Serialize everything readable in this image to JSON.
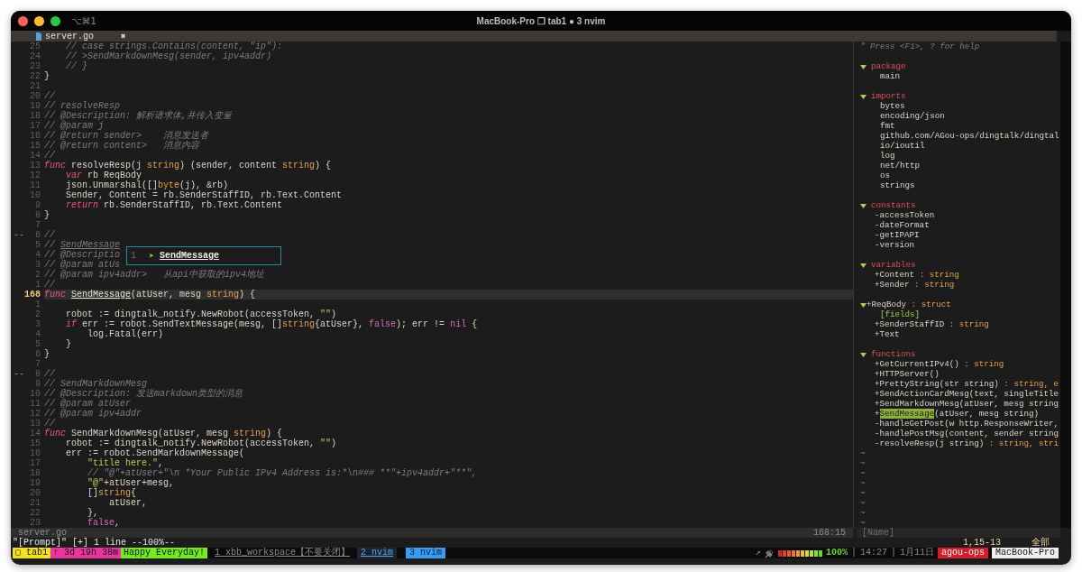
{
  "window": {
    "shortcut": "⌥⌘1",
    "title": "MacBook-Pro ❐ tab1 ● 3 nvim"
  },
  "tabline": {
    "tabs": [
      {
        "label": "server.go",
        "close": "✖",
        "selected": true
      }
    ]
  },
  "editor": {
    "lines": [
      {
        "number": "25",
        "current": false,
        "segments": [
          {
            "text": "    // case strings.Contains(content, \"ip\"):",
            "kind": "comment"
          }
        ]
      },
      {
        "number": "24",
        "current": false,
        "segments": [
          {
            "text": "    // >SendMarkdownMesg(sender, ipv4addr)",
            "kind": "comment"
          }
        ]
      },
      {
        "number": "23",
        "current": false,
        "segments": [
          {
            "text": "    // }",
            "kind": "comment"
          }
        ]
      },
      {
        "number": "22",
        "current": false,
        "segments": [
          {
            "text": "}",
            "kind": "plain"
          }
        ]
      },
      {
        "number": "21",
        "current": false
      },
      {
        "number": "20",
        "current": false,
        "segments": [
          {
            "text": "//",
            "kind": "comment"
          }
        ]
      },
      {
        "number": "19",
        "current": false,
        "segments": [
          {
            "text": "// resolveResp",
            "kind": "comment"
          }
        ]
      },
      {
        "number": "18",
        "current": false,
        "segments": [
          {
            "text": "// @Description: 解析请求体,并传入变量",
            "kind": "comment"
          }
        ]
      },
      {
        "number": "17",
        "current": false,
        "segments": [
          {
            "text": "// @param j",
            "kind": "comment"
          }
        ]
      },
      {
        "number": "16",
        "current": false,
        "segments": [
          {
            "text": "// @return sender>    消息发送者",
            "kind": "comment"
          }
        ]
      },
      {
        "number": "15",
        "current": false,
        "segments": [
          {
            "text": "// @return content>   消息内容",
            "kind": "comment"
          }
        ]
      },
      {
        "number": "14",
        "current": false,
        "segments": [
          {
            "text": "//",
            "kind": "comment"
          }
        ]
      },
      {
        "number": "13",
        "current": false,
        "segments": [
          {
            "text": "func",
            "kind": "keyword"
          },
          {
            "text": " resolveResp(j ",
            "kind": "plain"
          },
          {
            "text": "string",
            "kind": "type"
          },
          {
            "text": ") (sender, content ",
            "kind": "plain"
          },
          {
            "text": "string",
            "kind": "type"
          },
          {
            "text": ") {",
            "kind": "plain"
          }
        ]
      },
      {
        "number": "12",
        "current": false,
        "segments": [
          {
            "text": "    var",
            "kind": "keyword"
          },
          {
            "text": " rb ReqBody",
            "kind": "plain"
          }
        ]
      },
      {
        "number": "11",
        "current": false,
        "segments": [
          {
            "text": "    json.Unmarshal([]",
            "kind": "plain"
          },
          {
            "text": "byte",
            "kind": "type"
          },
          {
            "text": "(j), &rb)",
            "kind": "plain"
          }
        ]
      },
      {
        "number": "10",
        "current": false,
        "segments": [
          {
            "text": "    Sender, Content = rb.SenderStaffID, rb.Text.Content",
            "kind": "plain"
          }
        ]
      },
      {
        "number": "9",
        "current": false,
        "segments": [
          {
            "text": "    return",
            "kind": "keyword"
          },
          {
            "text": " rb.SenderStaffID, rb.Text.Content",
            "kind": "plain"
          }
        ]
      },
      {
        "number": "8",
        "current": false,
        "segments": [
          {
            "text": "}",
            "kind": "plain"
          }
        ]
      },
      {
        "number": "7",
        "current": false
      },
      {
        "number": "6",
        "sign": "--",
        "current": false,
        "segments": [
          {
            "text": "//",
            "kind": "comment"
          }
        ]
      },
      {
        "number": "5",
        "current": false,
        "segments": [
          {
            "text": "// ",
            "kind": "comment"
          },
          {
            "text": "SendMessage",
            "kind": "comment-match"
          }
        ]
      },
      {
        "number": "4",
        "current": false,
        "segments": [
          {
            "text": "// @Descriptio",
            "kind": "comment"
          }
        ]
      },
      {
        "number": "3",
        "current": false,
        "segments": [
          {
            "text": "// @param atUs",
            "kind": "comment"
          }
        ]
      },
      {
        "number": "2",
        "current": false,
        "segments": [
          {
            "text": "// @param ipv4addr>   从api中获取的ipv4地址",
            "kind": "comment"
          }
        ]
      },
      {
        "number": "1",
        "current": false,
        "segments": [
          {
            "text": "//",
            "kind": "comment"
          }
        ]
      },
      {
        "number": "168",
        "current": true,
        "segments": [
          {
            "text": "func ",
            "kind": "keyword"
          },
          {
            "text": "SendMessage",
            "kind": "match"
          },
          {
            "text": "(atUser, mesg ",
            "kind": "plain"
          },
          {
            "text": "string",
            "kind": "type"
          },
          {
            "text": ") {",
            "kind": "plain"
          }
        ]
      },
      {
        "number": "1",
        "current": false
      },
      {
        "number": "2",
        "current": false,
        "segments": [
          {
            "text": "    robot := dingtalk_notify.NewRobot(accessToken, ",
            "kind": "plain"
          },
          {
            "text": "\"\"",
            "kind": "string"
          },
          {
            "text": ")",
            "kind": "plain"
          }
        ]
      },
      {
        "number": "3",
        "current": false,
        "segments": [
          {
            "text": "    if",
            "kind": "keyword"
          },
          {
            "text": " err := robot.SendTextMessage(mesg, []",
            "kind": "plain"
          },
          {
            "text": "string",
            "kind": "type"
          },
          {
            "text": "{atUser}, ",
            "kind": "plain"
          },
          {
            "text": "false",
            "kind": "constant"
          },
          {
            "text": "); err != ",
            "kind": "plain"
          },
          {
            "text": "nil",
            "kind": "constant"
          },
          {
            "text": " {",
            "kind": "plain"
          }
        ]
      },
      {
        "number": "4",
        "current": false,
        "segments": [
          {
            "text": "        log.Fatal(err)",
            "kind": "plain"
          }
        ]
      },
      {
        "number": "5",
        "current": false,
        "segments": [
          {
            "text": "    }",
            "kind": "plain"
          }
        ]
      },
      {
        "number": "6",
        "current": false,
        "segments": [
          {
            "text": "}",
            "kind": "plain"
          }
        ]
      },
      {
        "number": "7",
        "current": false
      },
      {
        "number": "8",
        "sign": "--",
        "current": false,
        "segments": [
          {
            "text": "//",
            "kind": "comment"
          }
        ]
      },
      {
        "number": "9",
        "current": false,
        "segments": [
          {
            "text": "// SendMarkdownMesg",
            "kind": "comment"
          }
        ]
      },
      {
        "number": "10",
        "current": false,
        "segments": [
          {
            "text": "// @Description: 发送markdown类型的消息",
            "kind": "comment"
          }
        ]
      },
      {
        "number": "11",
        "current": false,
        "segments": [
          {
            "text": "// @param atUser",
            "kind": "comment"
          }
        ]
      },
      {
        "number": "12",
        "current": false,
        "segments": [
          {
            "text": "// @param ipv4addr",
            "kind": "comment"
          }
        ]
      },
      {
        "number": "13",
        "current": false,
        "segments": [
          {
            "text": "//",
            "kind": "comment"
          }
        ]
      },
      {
        "number": "14",
        "current": false,
        "segments": [
          {
            "text": "func",
            "kind": "keyword"
          },
          {
            "text": " SendMarkdownMesg(atUser, mesg ",
            "kind": "plain"
          },
          {
            "text": "string",
            "kind": "type"
          },
          {
            "text": ") {",
            "kind": "plain"
          }
        ]
      },
      {
        "number": "15",
        "current": false,
        "segments": [
          {
            "text": "    robot := dingtalk_notify.NewRobot(accessToken, ",
            "kind": "plain"
          },
          {
            "text": "\"\"",
            "kind": "string"
          },
          {
            "text": ")",
            "kind": "plain"
          }
        ]
      },
      {
        "number": "16",
        "current": false,
        "segments": [
          {
            "text": "    err := robot.SendMarkdownMessage(",
            "kind": "plain"
          }
        ]
      },
      {
        "number": "17",
        "current": false,
        "segments": [
          {
            "text": "        \"title here.\"",
            "kind": "string"
          },
          {
            "text": ",",
            "kind": "plain"
          }
        ]
      },
      {
        "number": "18",
        "current": false,
        "segments": [
          {
            "text": "        // \"@\"+atUser+\"\\n *Your Public IPv4 Address is:*\\n### **\"+ipv4addr+\"**\",",
            "kind": "comment"
          }
        ]
      },
      {
        "number": "19",
        "current": false,
        "segments": [
          {
            "text": "        \"@\"",
            "kind": "string"
          },
          {
            "text": "+atUser+mesg,",
            "kind": "plain"
          }
        ]
      },
      {
        "number": "20",
        "current": false,
        "segments": [
          {
            "text": "        []",
            "kind": "plain"
          },
          {
            "text": "string",
            "kind": "type"
          },
          {
            "text": "{",
            "kind": "plain"
          }
        ]
      },
      {
        "number": "21",
        "current": false,
        "segments": [
          {
            "text": "            atUser,",
            "kind": "plain"
          }
        ]
      },
      {
        "number": "22",
        "current": false,
        "segments": [
          {
            "text": "        },",
            "kind": "plain"
          }
        ]
      },
      {
        "number": "23",
        "current": false,
        "segments": [
          {
            "text": "        false",
            "kind": "constant"
          },
          {
            "text": ",",
            "kind": "plain"
          }
        ]
      }
    ],
    "completion": {
      "index": "1",
      "marker": "➤",
      "label": "SendMessage"
    }
  },
  "tagbar": {
    "help": "\" Press <F1>, ? for help",
    "sections": [
      {
        "label": "package",
        "expanded": true,
        "items": [
          {
            "name": "main"
          }
        ]
      },
      {
        "label": "imports",
        "expanded": true,
        "items": [
          {
            "name": "bytes"
          },
          {
            "name": "encoding/json"
          },
          {
            "name": "fmt"
          },
          {
            "name": "github.com/AGou-ops/dingtalk/dingtal"
          },
          {
            "name": "io/ioutil"
          },
          {
            "name": "log"
          },
          {
            "name": "net/http"
          },
          {
            "name": "os"
          },
          {
            "name": "strings"
          }
        ]
      },
      {
        "label": "constants",
        "expanded": true,
        "items": [
          {
            "scope": "-",
            "name": "accessToken"
          },
          {
            "scope": "-",
            "name": "dateFormat"
          },
          {
            "scope": "-",
            "name": "getIPAPI"
          },
          {
            "scope": "-",
            "name": "version"
          }
        ]
      },
      {
        "label": "variables",
        "expanded": true,
        "items": [
          {
            "scope": "+",
            "name": "Content",
            "type": " : string"
          },
          {
            "scope": "+",
            "name": "Sender",
            "type": " : string"
          }
        ]
      },
      {
        "label": "+ReqBody",
        "kind": "type",
        "type": " : struct",
        "expanded": true,
        "items": [
          {
            "name": "[fields]",
            "kind": "group"
          },
          {
            "scope": "+",
            "name": "SenderStaffID",
            "type": " : string"
          },
          {
            "scope": "+",
            "name": "Text"
          }
        ]
      },
      {
        "label": "functions",
        "expanded": true,
        "items": [
          {
            "scope": "+",
            "name": "GetCurrentIPv4",
            "rest": "()",
            "type": " : string",
            "selected": false
          },
          {
            "scope": "+",
            "name": "HTTPServer",
            "rest": "()",
            "selected": false
          },
          {
            "scope": "+",
            "name": "PrettyString",
            "rest": "(str string)",
            "type": " : string, e",
            "selected": false
          },
          {
            "scope": "+",
            "name": "SendActionCardMesg",
            "rest": "(text, singleTitle",
            "selected": false
          },
          {
            "scope": "+",
            "name": "SendMarkdownMesg",
            "rest": "(atUser, mesg string",
            "selected": false
          },
          {
            "scope": "+",
            "name": "SendMessage",
            "rest": "(atUser, mesg string)",
            "selected": true
          },
          {
            "scope": "-",
            "name": "handleGetPost",
            "rest": "(w http.ResponseWriter,",
            "selected": false
          },
          {
            "scope": "-",
            "name": "handlePostMsg",
            "rest": "(content, sender string",
            "selected": false
          },
          {
            "scope": "-",
            "name": "resolveResp",
            "rest": "(j string)",
            "type": " : string, stri",
            "selected": false
          }
        ]
      }
    ],
    "filler": [
      "~",
      "~",
      "~",
      "~",
      "~",
      "~",
      "~",
      "~"
    ]
  },
  "statusline": {
    "file": "server.go",
    "position": "168:15",
    "tagbar_name": "[Name]"
  },
  "cmdline": {
    "text": "\"[Prompt]\" [+] 1 line --100%--",
    "ruler": "1,15-13",
    "scroll": "全部"
  },
  "tmux": {
    "left": [
      {
        "text": "▢ tab1",
        "color": "#f3e21a"
      },
      {
        "text": "↑ 3d 19h 38m",
        "color": "#e8359f"
      },
      {
        "text": "Happy Everyday!",
        "color": "#72ec1c"
      }
    ],
    "windows": [
      {
        "label": "1 xbb_workspace【不要关闭】",
        "selected": false,
        "last": false
      },
      {
        "label": "2 nvim",
        "selected": false,
        "last": true
      },
      {
        "label": "3 nvim",
        "selected": true,
        "last": false
      }
    ],
    "right": [
      {
        "kind": "text",
        "text": "↗"
      },
      {
        "kind": "plug"
      },
      {
        "kind": "battery"
      },
      {
        "kind": "percent",
        "text": "100%"
      },
      {
        "kind": "text",
        "text": "|"
      },
      {
        "kind": "text",
        "text": "14:27"
      },
      {
        "kind": "text",
        "text": "|"
      },
      {
        "kind": "text",
        "text": "1月11日"
      },
      {
        "kind": "badge",
        "text": "agou-ops",
        "color": "#d81a2a"
      },
      {
        "kind": "badge",
        "text": "MacBook-Pro",
        "color": "#eeeeee"
      }
    ]
  }
}
